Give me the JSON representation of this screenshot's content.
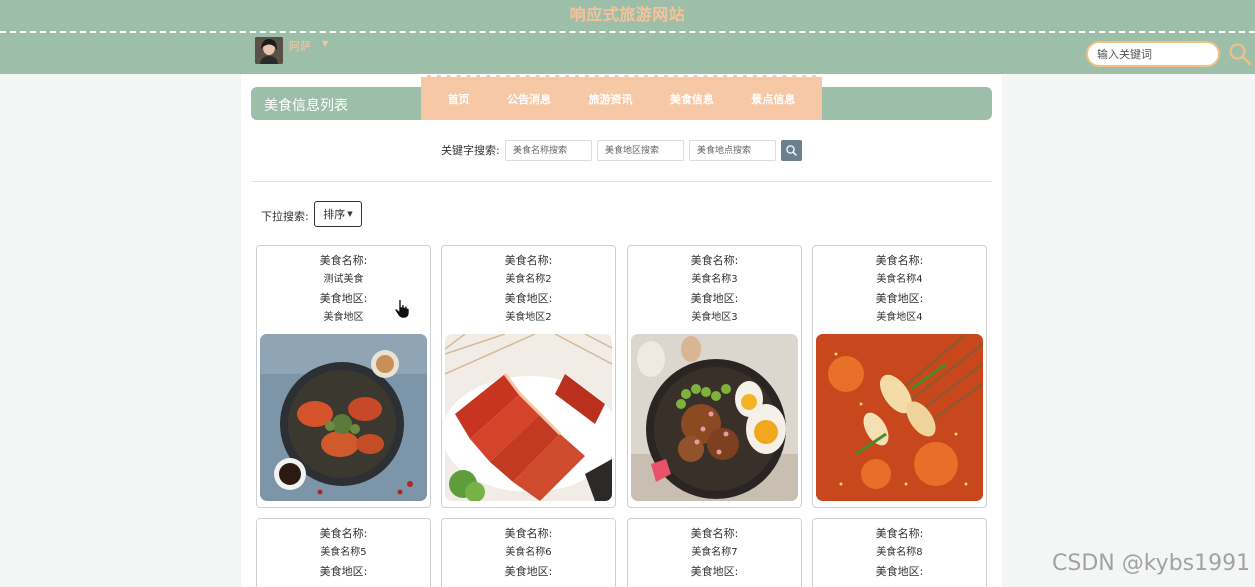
{
  "header": {
    "site_title": "响应式旅游网站",
    "user_name": "阿萨",
    "search_placeholder": "输入关键词"
  },
  "nav": {
    "items": [
      {
        "label": "首页"
      },
      {
        "label": "公告消息"
      },
      {
        "label": "旅游资讯"
      },
      {
        "label": "美食信息"
      },
      {
        "label": "景点信息"
      }
    ]
  },
  "list": {
    "title": "美食信息列表"
  },
  "filters": {
    "keyword_label": "关键字搜索:",
    "name_placeholder": "美食名称搜索",
    "region_placeholder": "美食地区搜索",
    "location_placeholder": "美食地点搜索",
    "dropdown_label": "下拉搜索:",
    "sort_label": "排序"
  },
  "cards": [
    {
      "name_label": "美食名称:",
      "name": "测试美食",
      "region_label": "美食地区:",
      "region": "美食地区"
    },
    {
      "name_label": "美食名称:",
      "name": "美食名称2",
      "region_label": "美食地区:",
      "region": "美食地区2"
    },
    {
      "name_label": "美食名称:",
      "name": "美食名称3",
      "region_label": "美食地区:",
      "region": "美食地区3"
    },
    {
      "name_label": "美食名称:",
      "name": "美食名称4",
      "region_label": "美食地区:",
      "region": "美食地区4"
    },
    {
      "name_label": "美食名称:",
      "name": "美食名称5",
      "region_label": "美食地区:",
      "region": ""
    },
    {
      "name_label": "美食名称:",
      "name": "美食名称6",
      "region_label": "美食地区:",
      "region": ""
    },
    {
      "name_label": "美食名称:",
      "name": "美食名称7",
      "region_label": "美食地区:",
      "region": ""
    },
    {
      "name_label": "美食名称:",
      "name": "美食名称8",
      "region_label": "美食地区:",
      "region": ""
    }
  ],
  "watermark": "CSDN @kybs1991",
  "colors": {
    "header_green": "#9dbfaa",
    "accent_peach": "#f7c8a6",
    "title_orange": "#f7c29a",
    "search_btn": "#6c7f8f"
  }
}
